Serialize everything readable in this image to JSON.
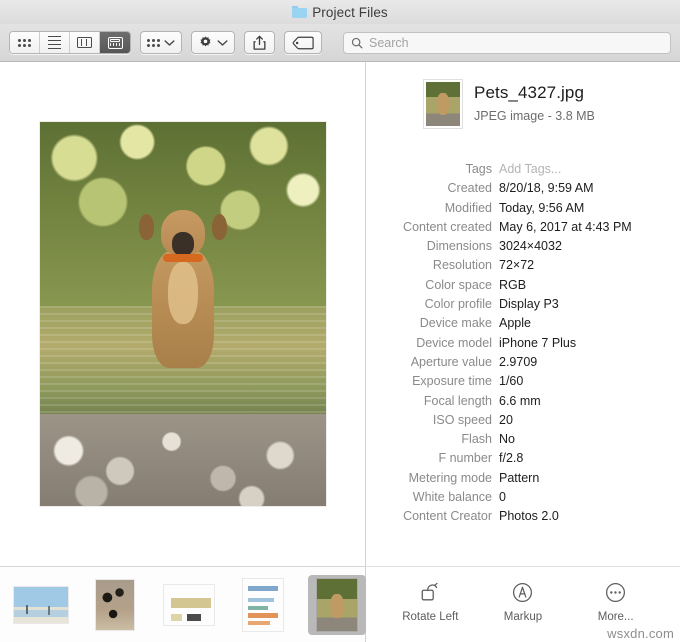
{
  "window": {
    "title": "Project Files",
    "folder_icon": "folder-icon"
  },
  "toolbar": {
    "view_modes": [
      {
        "name": "icon-view",
        "icon": "grid-icon",
        "selected": false
      },
      {
        "name": "list-view",
        "icon": "list-icon",
        "selected": false
      },
      {
        "name": "column-view",
        "icon": "columns-icon",
        "selected": false
      },
      {
        "name": "gallery-view",
        "icon": "gallery-icon",
        "selected": true
      }
    ],
    "group_button": {
      "name": "group-by",
      "icon": "grid-small-icon",
      "chevron": "chevron-down-icon"
    },
    "action_button": {
      "name": "action-menu",
      "icon": "gear-icon",
      "chevron": "chevron-down-icon"
    },
    "share_button": {
      "name": "share",
      "icon": "share-icon"
    },
    "tag_button": {
      "name": "tag",
      "icon": "tag-icon"
    },
    "search": {
      "icon": "search-icon",
      "placeholder": "Search",
      "value": ""
    }
  },
  "preview": {
    "image_alt": "Dog standing in a river",
    "thumbnails": [
      {
        "name": "thumb-beach",
        "kind": "beach",
        "selected": false
      },
      {
        "name": "thumb-flowers",
        "kind": "flowers",
        "selected": false
      },
      {
        "name": "thumb-document-1",
        "kind": "doc1",
        "selected": false
      },
      {
        "name": "thumb-document-2",
        "kind": "doc2",
        "selected": false
      },
      {
        "name": "thumb-pets",
        "kind": "dog",
        "selected": true
      }
    ]
  },
  "info": {
    "file_name": "Pets_4327.jpg",
    "file_subtitle": "JPEG image - 3.8 MB",
    "attributes": [
      {
        "label": "Tags",
        "value": "Add Tags...",
        "muted": true
      },
      {
        "label": "Created",
        "value": "8/20/18, 9:59 AM",
        "muted": false
      },
      {
        "label": "Modified",
        "value": "Today, 9:56 AM",
        "muted": false
      },
      {
        "label": "Content created",
        "value": "May 6, 2017 at 4:43 PM",
        "muted": false
      },
      {
        "label": "Dimensions",
        "value": "3024×4032",
        "muted": false
      },
      {
        "label": "Resolution",
        "value": "72×72",
        "muted": false
      },
      {
        "label": "Color space",
        "value": "RGB",
        "muted": false
      },
      {
        "label": "Color profile",
        "value": "Display P3",
        "muted": false
      },
      {
        "label": "Device make",
        "value": "Apple",
        "muted": false
      },
      {
        "label": "Device model",
        "value": "iPhone 7 Plus",
        "muted": false
      },
      {
        "label": "Aperture value",
        "value": "2.9709",
        "muted": false
      },
      {
        "label": "Exposure time",
        "value": "1/60",
        "muted": false
      },
      {
        "label": "Focal length",
        "value": "6.6 mm",
        "muted": false
      },
      {
        "label": "ISO speed",
        "value": "20",
        "muted": false
      },
      {
        "label": "Flash",
        "value": "No",
        "muted": false
      },
      {
        "label": "F number",
        "value": "f/2.8",
        "muted": false
      },
      {
        "label": "Metering mode",
        "value": "Pattern",
        "muted": false
      },
      {
        "label": "White balance",
        "value": "0",
        "muted": false
      },
      {
        "label": "Content Creator",
        "value": "Photos 2.0",
        "muted": false
      }
    ]
  },
  "actions": [
    {
      "name": "rotate-left-button",
      "label": "Rotate Left",
      "icon": "rotate-left-icon"
    },
    {
      "name": "markup-button",
      "label": "Markup",
      "icon": "markup-icon"
    },
    {
      "name": "more-button",
      "label": "More...",
      "icon": "ellipsis-icon"
    }
  ],
  "watermark": "wsxdn.com",
  "colors": {
    "selection": "#b9b9b9",
    "active_segment": "#575757",
    "folder": "#9bd3f2"
  }
}
